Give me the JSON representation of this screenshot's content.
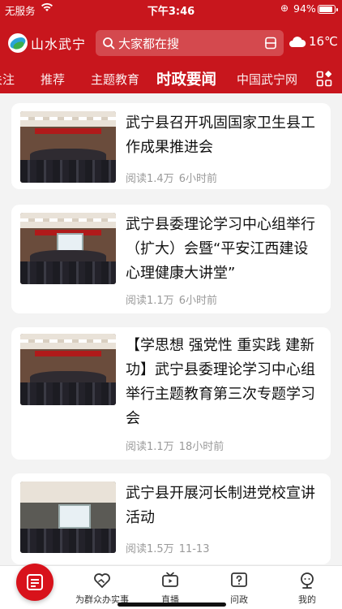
{
  "status_bar": {
    "carrier": "无服务",
    "time": "下午3:46",
    "battery_text": "94%",
    "battery_level": 0.94
  },
  "header": {
    "logo_text": "山水武宁",
    "search_placeholder": "大家都在搜",
    "weather_temp": "16℃",
    "weather_icon": "cloud-icon",
    "background": "#c8161d"
  },
  "tabs": [
    {
      "label": "关注"
    },
    {
      "label": "推荐"
    },
    {
      "label": "主题教育"
    },
    {
      "label": "时政要闻",
      "active": true
    },
    {
      "label": "中国武宁网"
    }
  ],
  "articles": [
    {
      "title": "武宁县召开巩固国家卫生县工作成果推进会",
      "reads": "阅读1.4万",
      "time": "6小时前"
    },
    {
      "title": "武宁县委理论学习中心组举行（扩大）会暨“平安江西建设心理健康大讲堂”",
      "reads": "阅读1.1万",
      "time": "6小时前"
    },
    {
      "title": "【学思想 强党性 重实践 建新功】武宁县委理论学习中心组举行主题教育第三次专题学习会",
      "reads": "阅读1.1万",
      "time": "18小时前"
    },
    {
      "title": "武宁县开展河长制进党校宣讲活动",
      "reads": "阅读1.5万",
      "time": "11-13"
    }
  ],
  "bottom_nav": [
    {
      "label": "",
      "icon": "news-icon"
    },
    {
      "label": "为群众办实事",
      "icon": "heart-hands-icon"
    },
    {
      "label": "直播",
      "icon": "tv-icon"
    },
    {
      "label": "问政",
      "icon": "question-icon"
    },
    {
      "label": "我的",
      "icon": "user-icon"
    }
  ],
  "colors": {
    "accent": "#c8161d",
    "home_button": "#d8121b"
  }
}
